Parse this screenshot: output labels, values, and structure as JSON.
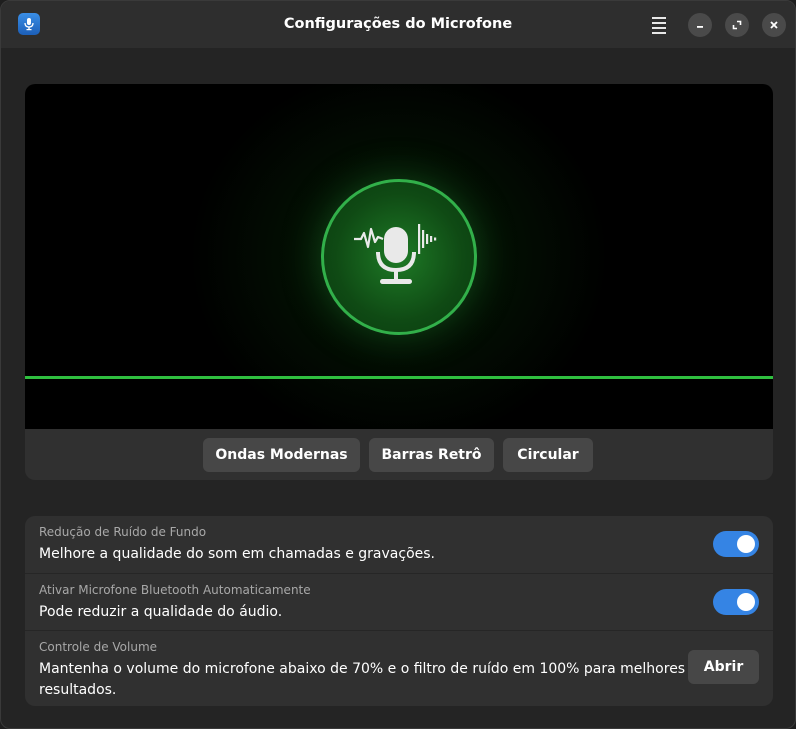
{
  "window": {
    "title": "Configurações do Microfone",
    "app_icon": "microphone-app-icon",
    "controls": [
      "menu-icon",
      "minimize-icon",
      "maximize-icon",
      "close-icon"
    ]
  },
  "visualizer": {
    "center_icon": "microphone-waveform-icon",
    "accent_color": "#2fbf3f",
    "styles": [
      {
        "label": "Ondas Modernas"
      },
      {
        "label": "Barras Retrô"
      },
      {
        "label": "Circular"
      }
    ]
  },
  "settings": [
    {
      "title": "Redução de Ruído de Fundo",
      "description": "Melhore a qualidade do som em chamadas e gravações.",
      "control": "toggle",
      "enabled": true
    },
    {
      "title": "Ativar Microfone Bluetooth Automaticamente",
      "description": "Pode reduzir a qualidade do áudio.",
      "control": "toggle",
      "enabled": true
    },
    {
      "title": "Controle de Volume",
      "description_line1": "Mantenha o volume do microfone abaixo de 70% e o filtro de ruído em 100% para melhores",
      "description_line2": "resultados.",
      "control": "button",
      "button_label": "Abrir"
    }
  ],
  "colors": {
    "toggle_on": "#3584e4",
    "window_bg": "#242424",
    "card_bg": "#303030"
  }
}
